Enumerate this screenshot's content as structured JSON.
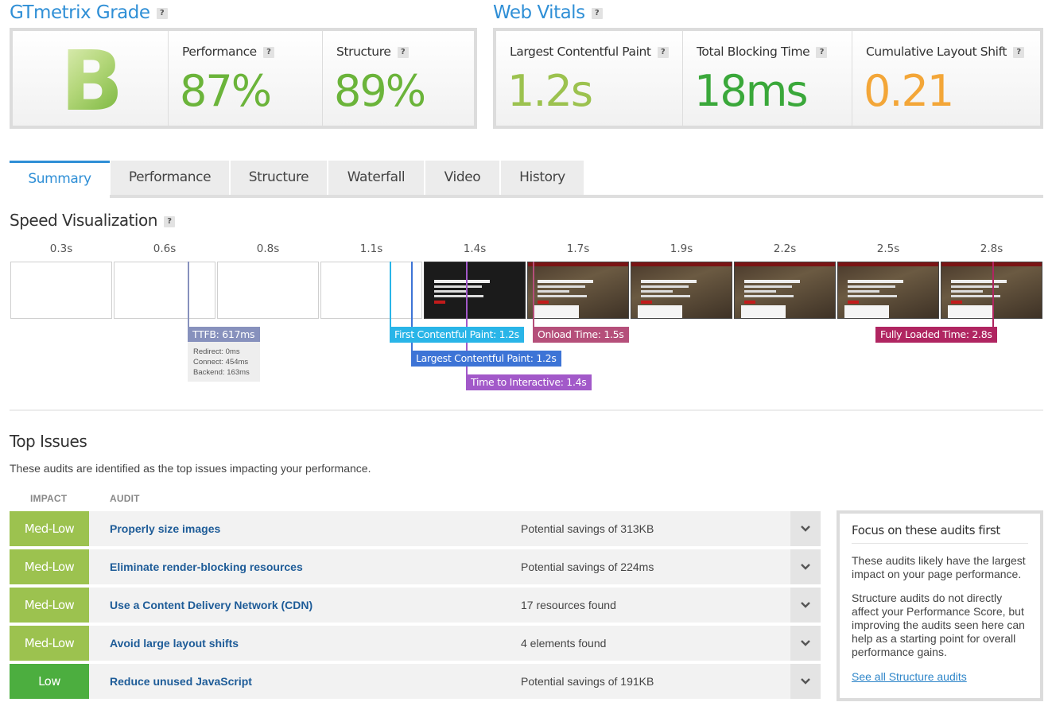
{
  "grade": {
    "title": "GTmetrix Grade",
    "help": "?",
    "letter": "B",
    "performance": {
      "label": "Performance",
      "value": "87%"
    },
    "structure": {
      "label": "Structure",
      "value": "89%"
    }
  },
  "vitals": {
    "title": "Web Vitals",
    "help": "?",
    "lcp": {
      "label": "Largest Contentful Paint",
      "value": "1.2s"
    },
    "tbt": {
      "label": "Total Blocking Time",
      "value": "18ms"
    },
    "cls": {
      "label": "Cumulative Layout Shift",
      "value": "0.21"
    }
  },
  "colors": {
    "accent": "#2f8fd6",
    "green": "#6bb43a",
    "light_green": "#9cc24f",
    "dark_green": "#3aa83a",
    "orange": "#f3a638"
  },
  "tabs": [
    "Summary",
    "Performance",
    "Structure",
    "Waterfall",
    "Video",
    "History"
  ],
  "speed": {
    "title": "Speed Visualization",
    "help": "?",
    "ticks": [
      "0.3s",
      "0.6s",
      "0.8s",
      "1.1s",
      "1.4s",
      "1.7s",
      "1.9s",
      "2.2s",
      "2.5s",
      "2.8s"
    ],
    "markers": {
      "ttfb": "TTFB: 617ms",
      "fcp": "First Contentful Paint: 1.2s",
      "lcp": "Largest Contentful Paint: 1.2s",
      "tti": "Time to Interactive: 1.4s",
      "onload": "Onload Time: 1.5s",
      "fully": "Fully Loaded Time: 2.8s"
    },
    "ttfb_detail": {
      "redirect": "Redirect: 0ms",
      "connect": "Connect: 454ms",
      "backend": "Backend: 163ms"
    }
  },
  "issues": {
    "title": "Top Issues",
    "subtitle": "These audits are identified as the top issues impacting your performance.",
    "col_impact": "IMPACT",
    "col_audit": "AUDIT",
    "rows": [
      {
        "impact": "Med-Low",
        "audit": "Properly size images",
        "savings": "Potential savings of 313KB"
      },
      {
        "impact": "Med-Low",
        "audit": "Eliminate render-blocking resources",
        "savings": "Potential savings of 224ms"
      },
      {
        "impact": "Med-Low",
        "audit": "Use a Content Delivery Network (CDN)",
        "savings": "17 resources found"
      },
      {
        "impact": "Med-Low",
        "audit": "Avoid large layout shifts",
        "savings": "4 elements found"
      },
      {
        "impact": "Low",
        "audit": "Reduce unused JavaScript",
        "savings": "Potential savings of 191KB"
      }
    ]
  },
  "focus": {
    "title": "Focus on these audits first",
    "p1": "These audits likely have the largest impact on your page performance.",
    "p2": "Structure audits do not directly affect your Performance Score, but improving the audits seen here can help as a starting point for overall performance gains.",
    "link": "See all Structure audits"
  }
}
